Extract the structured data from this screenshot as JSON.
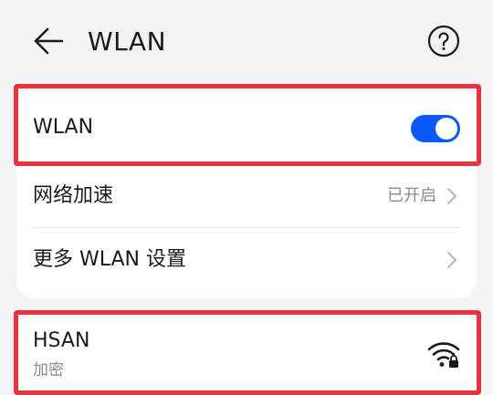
{
  "header": {
    "title": "WLAN",
    "back_icon": "arrow-left-icon",
    "help_icon": "question-circle-icon"
  },
  "settings": {
    "wlan_label": "WLAN",
    "wlan_enabled": true,
    "network_accel_label": "网络加速",
    "network_accel_status": "已开启",
    "more_settings_label": "更多 WLAN 设置"
  },
  "networks": [
    {
      "ssid": "HSAN",
      "security": "加密",
      "icon": "wifi-locked-icon"
    }
  ],
  "colors": {
    "background": "#f1f3f5",
    "card": "#ffffff",
    "accent": "#0a59f7",
    "highlight": "#e8323c",
    "secondary_text": "#8a8a8a"
  }
}
